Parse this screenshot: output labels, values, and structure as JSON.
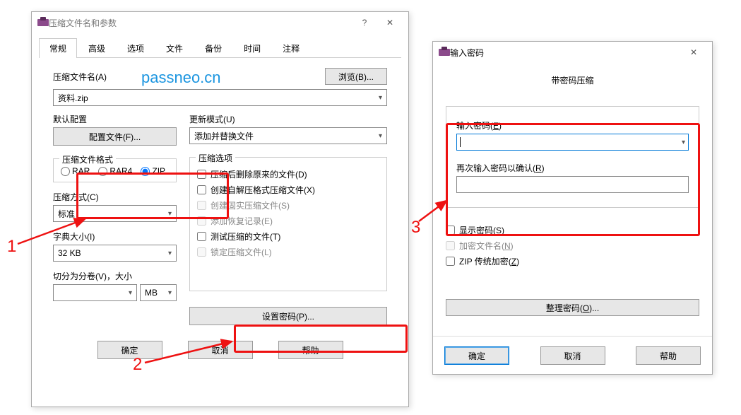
{
  "watermark": "passneo.cn",
  "dialog1": {
    "title": "压缩文件名和参数",
    "tabs": [
      "常规",
      "高级",
      "选项",
      "文件",
      "备份",
      "时间",
      "注释"
    ],
    "archive_name_label": "压缩文件名(A)",
    "browse_btn": "浏览(B)...",
    "archive_name_value": "资料.zip",
    "default_profile_label": "默认配置",
    "profiles_btn": "配置文件(F)...",
    "update_mode_label": "更新模式(U)",
    "update_mode_value": "添加并替换文件",
    "format_group": "压缩文件格式",
    "formats": {
      "rar": "RAR",
      "rar4": "RAR4",
      "zip": "ZIP"
    },
    "method_label": "压缩方式(C)",
    "method_value": "标准",
    "dict_label": "字典大小(I)",
    "dict_value": "32 KB",
    "split_label": "切分为分卷(V)，大小",
    "split_unit": "MB",
    "options_group": "压缩选项",
    "options": {
      "delete": "压缩后删除原来的文件(D)",
      "sfx": "创建自解压格式压缩文件(X)",
      "solid": "创建固实压缩文件(S)",
      "recovery": "添加恢复记录(E)",
      "test": "测试压缩的文件(T)",
      "lock": "锁定压缩文件(L)"
    },
    "set_password_btn": "设置密码(P)...",
    "ok": "确定",
    "cancel": "取消",
    "help": "帮助"
  },
  "dialog2": {
    "title": "输入密码",
    "subtitle": "带密码压缩",
    "enter_label_base": "输入密码(",
    "enter_label_u": "E",
    "enter_label_end": ")",
    "reenter_label_base": "再次输入密码以确认(",
    "reenter_label_u": "R",
    "reenter_label_end": ")",
    "show_pwd_base": "显示密码(",
    "show_pwd_u": "S",
    "show_pwd_end": ")",
    "encrypt_names_base": "加密文件名(",
    "encrypt_names_u": "N",
    "encrypt_names_end": ")",
    "zip_legacy_base": "ZIP 传统加密(",
    "zip_legacy_u": "Z",
    "zip_legacy_end": ")",
    "organize_base": "整理密码(",
    "organize_u": "O",
    "organize_end": ")...",
    "ok": "确定",
    "cancel": "取消",
    "help": "帮助"
  },
  "annotations": {
    "n1": "1",
    "n2": "2",
    "n3": "3"
  }
}
